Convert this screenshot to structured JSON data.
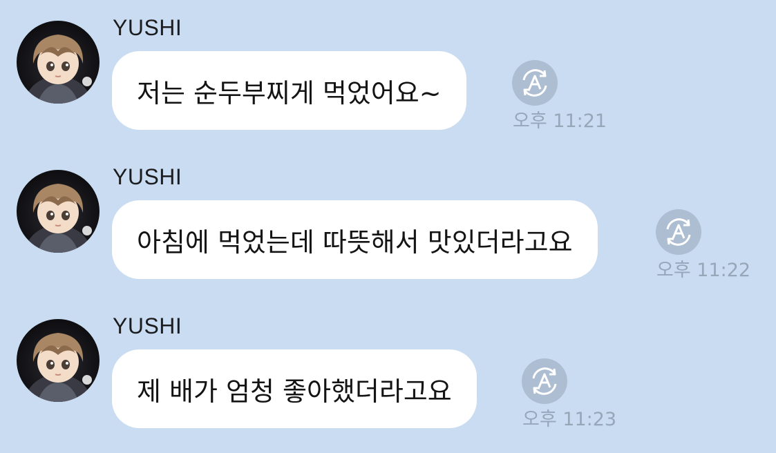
{
  "messages": [
    {
      "sender": "YUSHI",
      "text": "저는 순두부찌게 먹었어요~",
      "time": "오후 11:21",
      "translate_icon": "auto-translate-icon",
      "avatar_icon": "avatar-anime-boy"
    },
    {
      "sender": "YUSHI",
      "text": "아침에 먹었는데 따뜻해서 맛있더라고요",
      "time": "오후 11:22",
      "translate_icon": "auto-translate-icon",
      "avatar_icon": "avatar-anime-boy"
    },
    {
      "sender": "YUSHI",
      "text": "제 배가 엄청 좋아했더라고요",
      "time": "오후 11:23",
      "translate_icon": "auto-translate-icon",
      "avatar_icon": "avatar-anime-boy"
    }
  ],
  "colors": {
    "background": "#c9dcf1",
    "bubble": "#ffffff",
    "timestamp": "#97a6b8",
    "translate_button": "#aebed2"
  }
}
